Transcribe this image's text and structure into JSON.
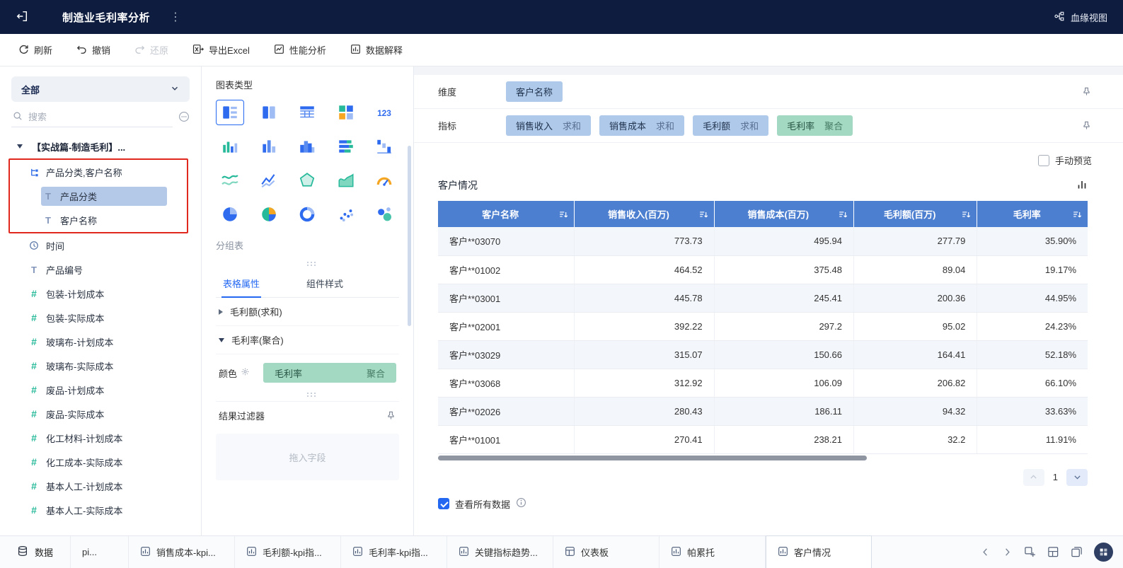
{
  "topbar": {
    "title": "制造业毛利率分析",
    "lineage_label": "血缘视图"
  },
  "toolbar": {
    "refresh": "刷新",
    "undo": "撤销",
    "redo": "还原",
    "export_excel": "导出Excel",
    "performance": "性能分析",
    "data_explain": "数据解释"
  },
  "sidebar": {
    "scope_selector": "全部",
    "search_placeholder": "搜索",
    "tree": [
      {
        "label": "【实战篇-制造毛利】...",
        "icon": "caret",
        "level": 0,
        "bold": true
      },
      {
        "label": "产品分类,客户名称",
        "icon": "hierarchy",
        "level": 1,
        "annotated": true
      },
      {
        "label": "产品分类",
        "icon": "text",
        "level": 2,
        "selected": true,
        "annotated": true
      },
      {
        "label": "客户名称",
        "icon": "text",
        "level": 2,
        "annotated": true
      },
      {
        "label": "时间",
        "icon": "clock",
        "level": 1
      },
      {
        "label": "产品编号",
        "icon": "text",
        "level": 1
      },
      {
        "label": "包装-计划成本",
        "icon": "number",
        "level": 1
      },
      {
        "label": "包装-实际成本",
        "icon": "number",
        "level": 1
      },
      {
        "label": "玻璃布-计划成本",
        "icon": "number",
        "level": 1
      },
      {
        "label": "玻璃布-实际成本",
        "icon": "number",
        "level": 1
      },
      {
        "label": "废品-计划成本",
        "icon": "number",
        "level": 1
      },
      {
        "label": "废品-实际成本",
        "icon": "number",
        "level": 1
      },
      {
        "label": "化工材料-计划成本",
        "icon": "number",
        "level": 1
      },
      {
        "label": "化工成本-实际成本",
        "icon": "number",
        "level": 1
      },
      {
        "label": "基本人工-计划成本",
        "icon": "number",
        "level": 1
      },
      {
        "label": "基本人工-实际成本",
        "icon": "number",
        "level": 1
      }
    ]
  },
  "panel": {
    "chart_type_label": "图表类型",
    "chart_types": [
      "grouped-table",
      "cross-table",
      "data-table",
      "card-grid",
      "kpi-number",
      "cluster-column",
      "column-chart",
      "histogram",
      "stacked-bar",
      "waterfall",
      "stream-chart",
      "line-chart",
      "radar-chart",
      "area-chart",
      "gauge-chart",
      "pie-chart",
      "multi-pie-chart",
      "donut-chart",
      "scatter-chart",
      "bubble-chart"
    ],
    "selected_chart_index": 0,
    "selected_chart_label": "分组表",
    "tabs": [
      {
        "label": "表格属性",
        "active": true
      },
      {
        "label": "组件样式",
        "active": false
      }
    ],
    "accordions": [
      {
        "label": "毛利额(求和)",
        "expanded": false
      },
      {
        "label": "毛利率(聚合)",
        "expanded": true
      }
    ],
    "color_label": "颜色",
    "color_pill": {
      "label": "毛利率",
      "agg": "聚合"
    },
    "result_filter_label": "结果过滤器",
    "drop_hint": "拖入字段"
  },
  "editor": {
    "dimension_label": "维度",
    "dimension_pills": [
      {
        "label": "客户名称"
      }
    ],
    "metric_label": "指标",
    "metric_pills": [
      {
        "label": "销售收入",
        "agg": "求和",
        "style": "blue"
      },
      {
        "label": "销售成本",
        "agg": "求和",
        "style": "blue"
      },
      {
        "label": "毛利额",
        "agg": "求和",
        "style": "blue"
      },
      {
        "label": "毛利率",
        "agg": "聚合",
        "style": "green"
      }
    ],
    "manual_preview_label": "手动预览",
    "manual_preview_checked": false,
    "chart_title": "客户情况",
    "view_all_label": "查看所有数据",
    "view_all_checked": true,
    "page_number": "1"
  },
  "table": {
    "columns": [
      "客户名称",
      "销售收入(百万)",
      "销售成本(百万)",
      "毛利额(百万)",
      "毛利率"
    ],
    "rows": [
      [
        "客户**03070",
        "773.73",
        "495.94",
        "277.79",
        "35.90%"
      ],
      [
        "客户**01002",
        "464.52",
        "375.48",
        "89.04",
        "19.17%"
      ],
      [
        "客户**03001",
        "445.78",
        "245.41",
        "200.36",
        "44.95%"
      ],
      [
        "客户**02001",
        "392.22",
        "297.2",
        "95.02",
        "24.23%"
      ],
      [
        "客户**03029",
        "315.07",
        "150.66",
        "164.41",
        "52.18%"
      ],
      [
        "客户**03068",
        "312.92",
        "106.09",
        "206.82",
        "66.10%"
      ],
      [
        "客户**02026",
        "280.43",
        "186.11",
        "94.32",
        "33.63%"
      ],
      [
        "客户**01001",
        "270.41",
        "238.21",
        "32.2",
        "11.91%"
      ]
    ]
  },
  "bottombar": {
    "data_label": "数据",
    "tabs": [
      {
        "label": "pi...",
        "icon": "chart",
        "partial": true
      },
      {
        "label": "销售成本-kpi...",
        "icon": "chart"
      },
      {
        "label": "毛利额-kpi指...",
        "icon": "chart"
      },
      {
        "label": "毛利率-kpi指...",
        "icon": "chart"
      },
      {
        "label": "关键指标趋势...",
        "icon": "chart"
      },
      {
        "label": "仪表板",
        "icon": "dashboard"
      },
      {
        "label": "帕累托",
        "icon": "chart"
      },
      {
        "label": "客户情况",
        "icon": "chart",
        "active": true
      }
    ]
  },
  "colors": {
    "topbar_bg": "#0d1c3f",
    "accent_blue": "#2468f2",
    "table_header_blue": "#4d7fd0",
    "pill_blue": "#aec9ea",
    "pill_green": "#a3d8c2",
    "field_teal": "#26b99a",
    "annotation_red": "#e0281e"
  }
}
